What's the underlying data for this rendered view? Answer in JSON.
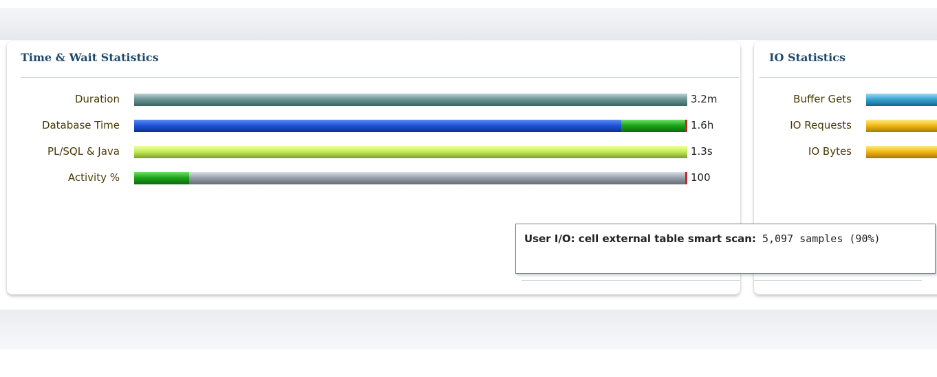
{
  "time_panel": {
    "title": "Time & Wait Statistics",
    "rows": [
      {
        "label": "Duration",
        "value": "3.2m"
      },
      {
        "label": "Database Time",
        "value": "1.6h"
      },
      {
        "label": "PL/SQL & Java",
        "value": "1.3s"
      },
      {
        "label": "Activity %",
        "value": "100"
      }
    ],
    "bar_fractions": {
      "duration": 1.0,
      "database_time_cpu": 0.88,
      "database_time_wait": 0.12,
      "plsql_java": 1.0,
      "activity_cpu": 0.1,
      "activity_user_io": 0.9
    }
  },
  "io_panel": {
    "title": "IO Statistics",
    "rows": [
      {
        "label": "Buffer Gets"
      },
      {
        "label": "IO Requests"
      },
      {
        "label": "IO Bytes"
      }
    ]
  },
  "tooltip": {
    "label": "User I/O: cell external table smart scan:",
    "detail": "5,097 samples (90%)"
  },
  "colors": {
    "teal": "#5a8482",
    "blue": "#1f56d8",
    "green": "#1fa61c",
    "lime": "#c5ef5b",
    "gray": "#9aa2ad",
    "cyan": "#3aa5d3",
    "gold": "#f2bc17",
    "cap_red": "#c4262e",
    "title_blue": "#1f4a6e",
    "label_brown": "#4a3a06"
  }
}
